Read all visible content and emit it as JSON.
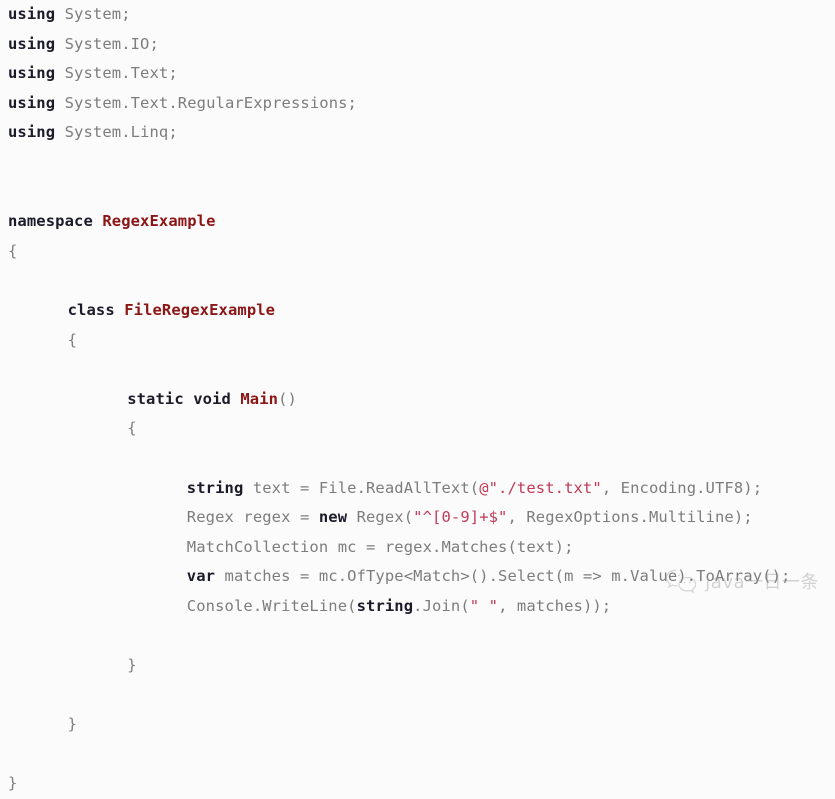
{
  "page": {
    "kind": "code-snippet-image",
    "language": "C#",
    "background_color": "#fbfbfb"
  },
  "colors": {
    "plain": "#7d7d7d",
    "keyword": "#1b1b2a",
    "type": "#8c1515",
    "string": "#c23a57",
    "watermark": "#9a9a9a"
  },
  "code": {
    "lines": [
      {
        "indent": 0,
        "tokens": [
          {
            "t": "keyword",
            "s": "using"
          },
          {
            "t": "plain",
            "s": " System;"
          }
        ]
      },
      {
        "indent": 0,
        "tokens": [
          {
            "t": "keyword",
            "s": "using"
          },
          {
            "t": "plain",
            "s": " System.IO;"
          }
        ]
      },
      {
        "indent": 0,
        "tokens": [
          {
            "t": "keyword",
            "s": "using"
          },
          {
            "t": "plain",
            "s": " System.Text;"
          }
        ]
      },
      {
        "indent": 0,
        "tokens": [
          {
            "t": "keyword",
            "s": "using"
          },
          {
            "t": "plain",
            "s": " System.Text.RegularExpressions;"
          }
        ]
      },
      {
        "indent": 0,
        "tokens": [
          {
            "t": "keyword",
            "s": "using"
          },
          {
            "t": "plain",
            "s": " System.Linq;"
          }
        ]
      },
      {
        "indent": 0,
        "tokens": []
      },
      {
        "indent": 0,
        "tokens": []
      },
      {
        "indent": 0,
        "tokens": [
          {
            "t": "keyword",
            "s": "namespace"
          },
          {
            "t": "plain",
            "s": " "
          },
          {
            "t": "type",
            "s": "RegexExample"
          }
        ]
      },
      {
        "indent": 0,
        "tokens": [
          {
            "t": "plain",
            "s": "{"
          }
        ]
      },
      {
        "indent": 0,
        "tokens": []
      },
      {
        "indent": 4,
        "tokens": [
          {
            "t": "keyword",
            "s": "class"
          },
          {
            "t": "plain",
            "s": " "
          },
          {
            "t": "type",
            "s": "FileRegexExample"
          }
        ]
      },
      {
        "indent": 4,
        "tokens": [
          {
            "t": "plain",
            "s": "{"
          }
        ]
      },
      {
        "indent": 0,
        "tokens": []
      },
      {
        "indent": 8,
        "tokens": [
          {
            "t": "keyword",
            "s": "static void"
          },
          {
            "t": "plain",
            "s": " "
          },
          {
            "t": "type",
            "s": "Main"
          },
          {
            "t": "plain",
            "s": "()"
          }
        ]
      },
      {
        "indent": 8,
        "tokens": [
          {
            "t": "plain",
            "s": "{"
          }
        ]
      },
      {
        "indent": 0,
        "tokens": []
      },
      {
        "indent": 12,
        "tokens": [
          {
            "t": "keyword",
            "s": "string"
          },
          {
            "t": "plain",
            "s": " text = File.ReadAllText("
          },
          {
            "t": "string",
            "s": "@\"./test.txt\""
          },
          {
            "t": "plain",
            "s": ", Encoding.UTF8);"
          }
        ]
      },
      {
        "indent": 12,
        "tokens": [
          {
            "t": "plain",
            "s": "Regex regex = "
          },
          {
            "t": "keyword",
            "s": "new"
          },
          {
            "t": "plain",
            "s": " Regex("
          },
          {
            "t": "string",
            "s": "\"^[0-9]+$\""
          },
          {
            "t": "plain",
            "s": ", RegexOptions.Multiline);"
          }
        ]
      },
      {
        "indent": 12,
        "tokens": [
          {
            "t": "plain",
            "s": "MatchCollection mc = regex.Matches(text);"
          }
        ]
      },
      {
        "indent": 12,
        "tokens": [
          {
            "t": "keyword",
            "s": "var"
          },
          {
            "t": "plain",
            "s": " matches = mc.OfType<Match>().Select(m => m.Value).ToArray();"
          }
        ]
      },
      {
        "indent": 12,
        "tokens": [
          {
            "t": "plain",
            "s": "Console.WriteLine("
          },
          {
            "t": "keyword",
            "s": "string"
          },
          {
            "t": "plain",
            "s": ".Join("
          },
          {
            "t": "string",
            "s": "\" \""
          },
          {
            "t": "plain",
            "s": ", matches));"
          }
        ]
      },
      {
        "indent": 0,
        "tokens": []
      },
      {
        "indent": 8,
        "tokens": [
          {
            "t": "plain",
            "s": "}"
          }
        ]
      },
      {
        "indent": 0,
        "tokens": []
      },
      {
        "indent": 4,
        "tokens": [
          {
            "t": "plain",
            "s": "}"
          }
        ]
      },
      {
        "indent": 0,
        "tokens": []
      },
      {
        "indent": 0,
        "tokens": [
          {
            "t": "plain",
            "s": "}"
          }
        ]
      }
    ]
  },
  "watermark": {
    "icon": "wechat-logo-icon",
    "label": "java一日一条"
  }
}
